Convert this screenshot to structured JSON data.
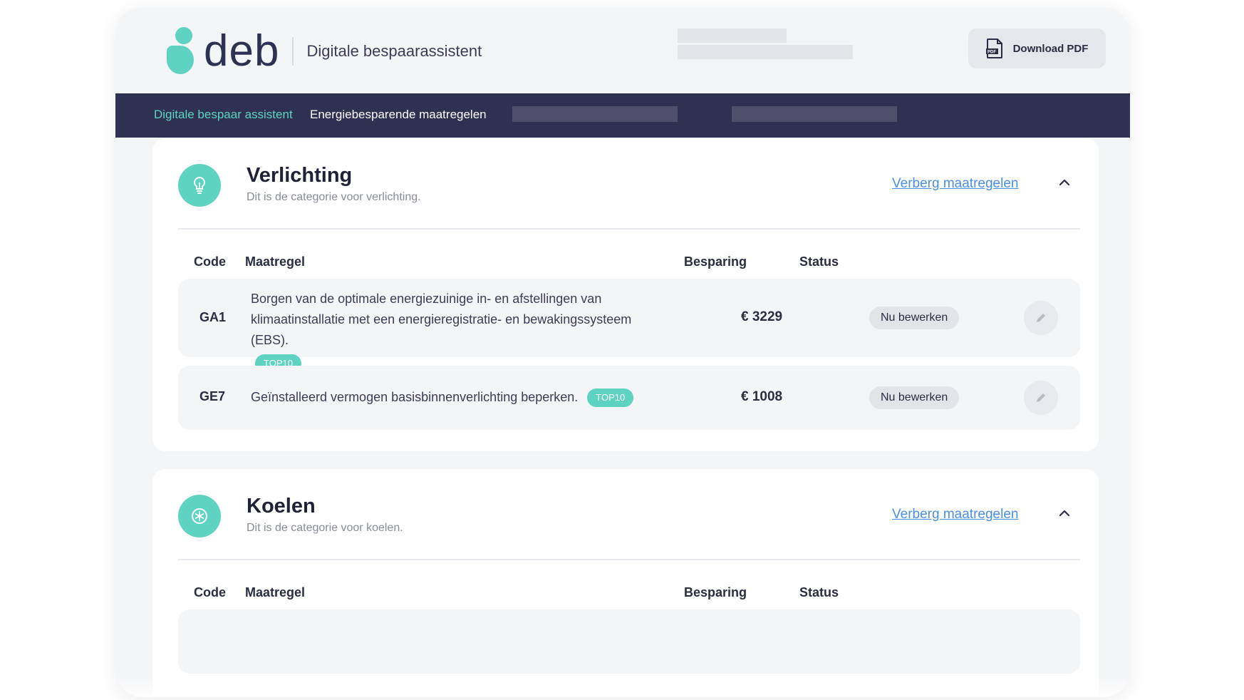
{
  "brand": {
    "logo_text": "deb",
    "subtitle": "Digitale bespaarassistent",
    "accent_color": "#5fd3c2",
    "nav_color": "#2f3153",
    "link_color": "#4a8fe7"
  },
  "header": {
    "download_label": "Download PDF",
    "download_icon": "pdf-file-icon"
  },
  "nav": {
    "items": [
      {
        "label": "Digitale bespaar assistent",
        "active": true
      },
      {
        "label": "Energiebesparende maatregelen",
        "active": false
      }
    ]
  },
  "categories": [
    {
      "title": "Verlichting",
      "description": "Dit is de categorie voor verlichting.",
      "icon": "lightbulb-icon",
      "toggle_label": "Verberg maatregelen",
      "columns": {
        "code": "Code",
        "measure": "Maatregel",
        "saving": "Besparing",
        "status": "Status"
      },
      "rows": [
        {
          "code": "GA1",
          "description": "Borgen van de optimale energiezuinige in- en afstellingen van klimaatinstallatie met een energieregistratie- en bewakingssysteem (EBS).",
          "badge": "TOP10",
          "saving": "€ 3229",
          "status": "Nu bewerken"
        },
        {
          "code": "GE7",
          "description": "Geïnstalleerd vermogen basisbinnenverlichting beperken.",
          "badge": "TOP10",
          "saving": "€ 1008",
          "status": "Nu bewerken"
        }
      ]
    },
    {
      "title": "Koelen",
      "description": "Dit is de categorie voor koelen.",
      "icon": "snowflake-icon",
      "toggle_label": "Verberg maatregelen",
      "columns": {
        "code": "Code",
        "measure": "Maatregel",
        "saving": "Besparing",
        "status": "Status"
      }
    }
  ]
}
